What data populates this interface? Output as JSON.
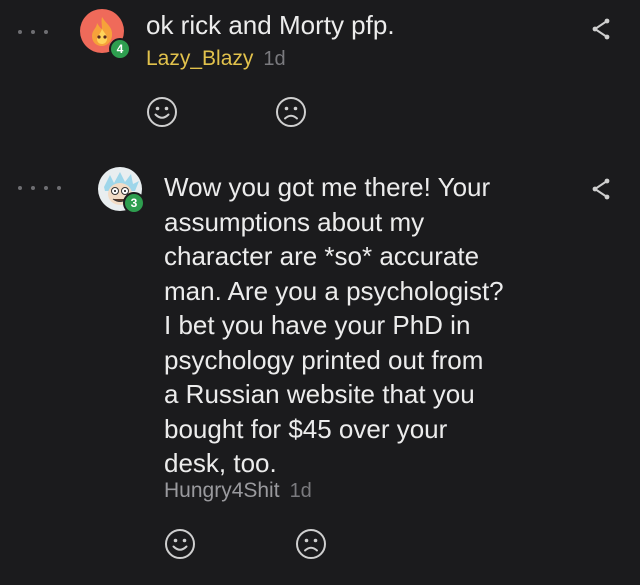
{
  "comments": [
    {
      "text": "ok rick and Morty pfp.",
      "username": "Lazy_Blazy",
      "time": "1d",
      "level": "4",
      "level_color": "#2e9e4f",
      "username_color": "#e2c24c",
      "avatar_icon": "flame-avatar-icon",
      "reactions": [
        "smile-icon",
        "frown-icon"
      ]
    },
    {
      "text": "Wow you got me there! Your\nassumptions about my\ncharacter are *so* accurate\nman. Are you a psychologist?\nI bet you have your PhD in\npsychology printed out from\na Russian website that you\nbought for $45 over your\ndesk, too.",
      "username": "Hungry4Shit",
      "time": "1d",
      "level": "3",
      "level_color": "#2e9e4f",
      "username_color": "#9a9a9e",
      "avatar_icon": "rick-avatar-icon",
      "reactions": [
        "smile-icon",
        "frown-icon"
      ]
    }
  ]
}
